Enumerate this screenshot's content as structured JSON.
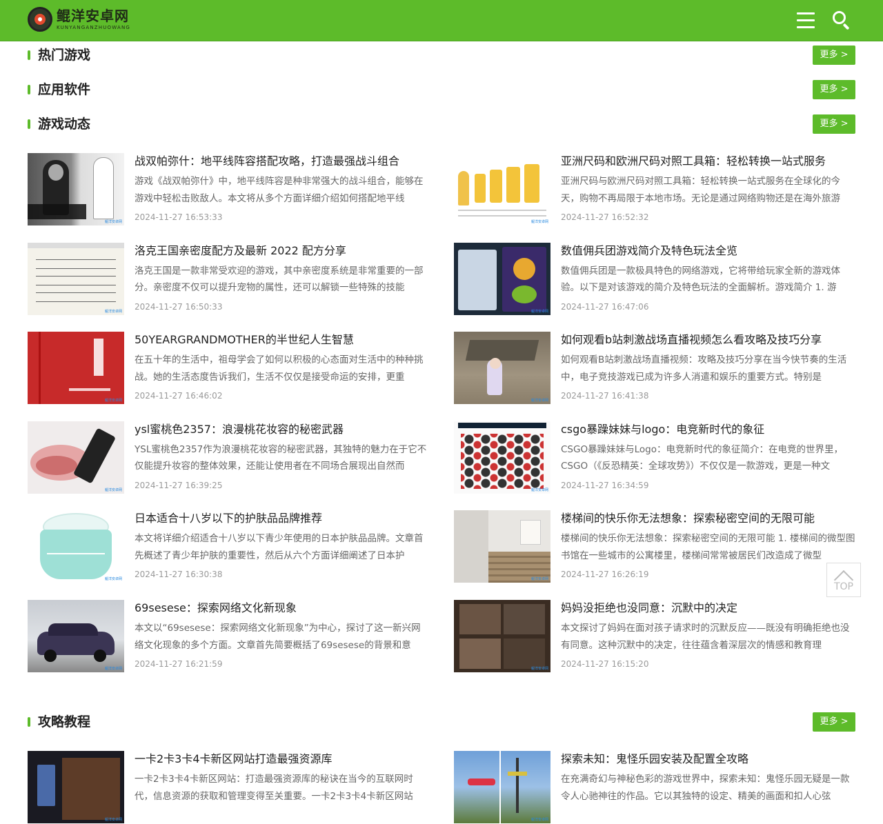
{
  "header": {
    "logo_cn": "鲲洋安卓网",
    "logo_en": "KUNYANGANZHUOWANG"
  },
  "sections": {
    "hot_games": {
      "title": "热门游戏",
      "more": "更多 >"
    },
    "apps": {
      "title": "应用软件",
      "more": "更多 >"
    },
    "news": {
      "title": "游戏动态",
      "more": "更多 >"
    },
    "guides": {
      "title": "攻略教程",
      "more": "更多 >"
    }
  },
  "news_articles": [
    {
      "title": "战双帕弥什：地平线阵容搭配攻略，打造最强战斗组合",
      "desc": "游戏《战双帕弥什》中，地平线阵容是种非常强大的战斗组合，能够在游戏中轻松击败敌人。本文将从多个方面详细介绍如何搭配地平线",
      "date": "2024-11-27 16:53:33",
      "thumb": "anime-characters"
    },
    {
      "title": "亚洲尺码和欧洲尺码对照工具箱：轻松转换一站式服务",
      "desc": "亚洲尺码与欧洲尺码对照工具箱：轻松转换一站式服务在全球化的今天，购物不再局限于本地市场。无论是通过网络购物还是在海外旅游",
      "date": "2024-11-27 16:52:32",
      "thumb": "luggage-size-chart"
    },
    {
      "title": "洛克王国亲密度配方及最新 2022 配方分享",
      "desc": "洛克王国是一款非常受欢迎的游戏，其中亲密度系统是非常重要的一部分。亲密度不仅可以提升宠物的属性，还可以解锁一些特殊的技能",
      "date": "2024-11-27 16:50:33",
      "thumb": "sheet-music"
    },
    {
      "title": "数值佣兵团游戏简介及特色玩法全览",
      "desc": "数值佣兵团是一款极具特色的网络游戏，它将带给玩家全新的游戏体验。以下是对该游戏的简介及特色玩法的全面解析。游戏简介 1. 游",
      "date": "2024-11-27 16:47:06",
      "thumb": "game-screens"
    },
    {
      "title": "50YEARGRANDMOTHER的半世纪人生智慧",
      "desc": "在五十年的生活中，祖母学会了如何以积极的心态面对生活中的种种挑战。她的生活态度告诉我们，生活不仅仅是接受命运的安排，更重",
      "date": "2024-11-27 16:46:02",
      "thumb": "red-book"
    },
    {
      "title": "如何观看b站刺激战场直播视频怎么看攻略及技巧分享",
      "desc": "如何观看B站刺激战场直播视频：攻略及技巧分享在当今快节奏的生活中，电子竞技游戏已成为许多人消遣和娱乐的重要方式。特别是",
      "date": "2024-11-27 16:41:38",
      "thumb": "game-scene"
    },
    {
      "title": "ysl蜜桃色2357：浪漫桃花妆容的秘密武器",
      "desc": "YSL蜜桃色2357作为浪漫桃花妆容的秘密武器，其独特的魅力在于它不仅能提升妆容的整体效果，还能让使用者在不同场合展现出自然而",
      "date": "2024-11-27 16:39:25",
      "thumb": "lipstick"
    },
    {
      "title": "csgo暴躁妹妹与logo：电竞新时代的象征",
      "desc": "CSGO暴躁妹妹与Logo：电竞新时代的象征简介：在电竞的世界里，CSGO（《反恐精英：全球攻势》）不仅仅是一款游戏，更是一种文",
      "date": "2024-11-27 16:34:59",
      "thumb": "team-logos"
    },
    {
      "title": "日本适合十八岁以下的护肤品品牌推荐",
      "desc": "本文将详细介绍适合十八岁以下青少年使用的日本护肤品品牌。文章首先概述了青少年护肤的重要性，然后从六个方面详细阐述了日本护",
      "date": "2024-11-27 16:30:38",
      "thumb": "skincare-jar"
    },
    {
      "title": "楼梯间的快乐你无法想象：探索秘密空间的无限可能",
      "desc": "楼梯间的快乐你无法想象：探索秘密空间的无限可能 1. 楼梯间的微型图书馆在一些城市的公寓楼里，楼梯间常常被居民们改造成了微型",
      "date": "2024-11-27 16:26:19",
      "thumb": "staircase"
    },
    {
      "title": "69sesese：探索网络文化新现象",
      "desc": "本文以“69sesese：探索网络文化新现象”为中心，探讨了这一新兴网络文化现象的多个方面。文章首先简要概括了69sesese的背景和意",
      "date": "2024-11-27 16:21:59",
      "thumb": "car"
    },
    {
      "title": "妈妈没拒绝也没同意：沉默中的决定",
      "desc": "本文探讨了妈妈在面对孩子请求时的沉默反应——既没有明确拒绝也没有同意。这种沉默中的决定，往往蕴含着深层次的情感和教育理",
      "date": "2024-11-27 16:15:20",
      "thumb": "video-stills"
    }
  ],
  "guide_articles": [
    {
      "title": "一卡2卡3卡4卡新区网站打造最强资源库",
      "desc": "一卡2卡3卡4卡新区网站：打造最强资源库的秘诀在当今的互联网时代，信息资源的获取和管理变得至关重要。一卡2卡3卡4卡新区网站",
      "thumb": "card-game"
    },
    {
      "title": "探索未知：鬼怪乐园安装及配置全攻略",
      "desc": "在充满奇幻与神秘色彩的游戏世界中，探索未知：鬼怪乐园无疑是一款令人心驰神往的作品。它以其独特的设定、精美的画面和扣人心弦",
      "thumb": "amusement-park"
    }
  ],
  "totop": {
    "label": "TOP"
  },
  "watermark": "鲲洋安卓网",
  "colors": {
    "brand": "#5dbb2a",
    "title": "#222222",
    "desc": "#666666",
    "date": "#999999"
  }
}
